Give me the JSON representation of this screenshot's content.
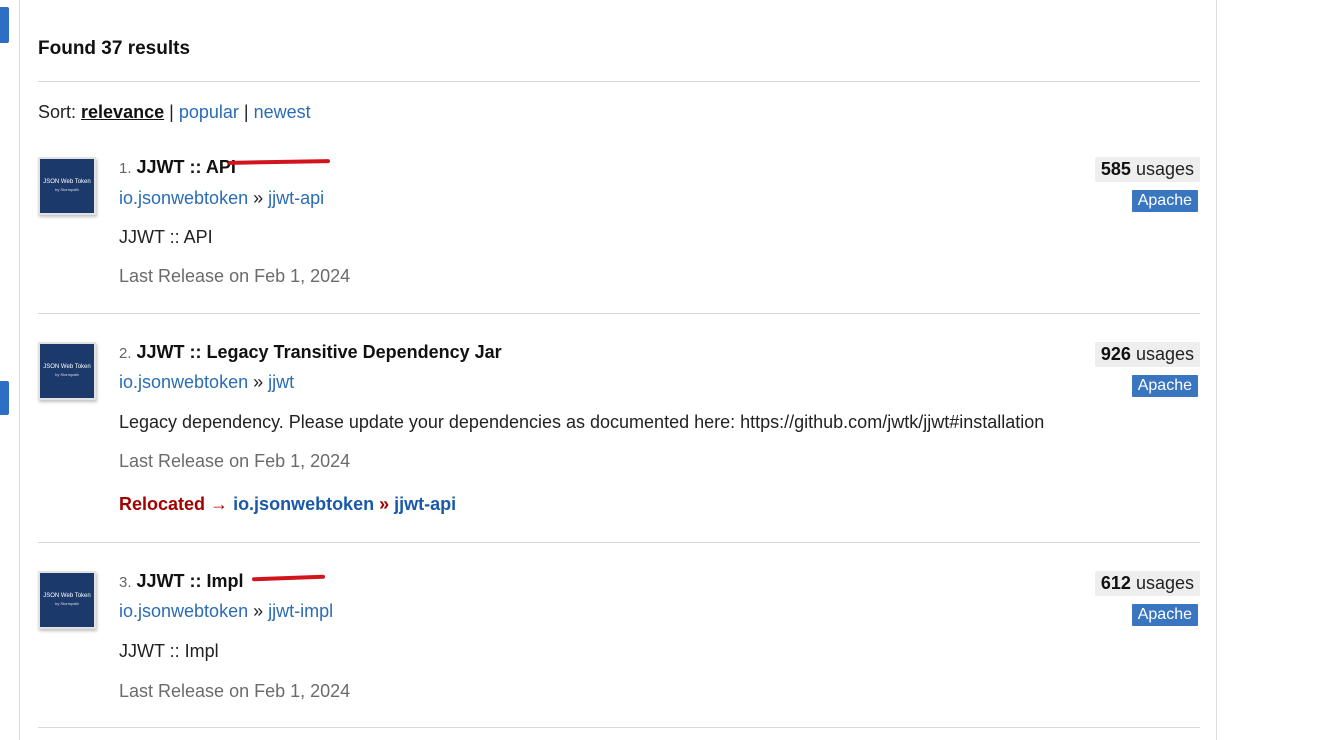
{
  "summary": {
    "found_text": "Found 37 results"
  },
  "sort": {
    "label": "Sort:",
    "options": [
      "relevance",
      "popular",
      "newest"
    ],
    "separator": "|"
  },
  "results": [
    {
      "index": "1.",
      "title": "JJWT :: API",
      "group": "io.jsonwebtoken",
      "artifact": "jjwt-api",
      "coord_sep": "»",
      "description": "JJWT :: API",
      "release": "Last Release on Feb 1, 2024",
      "usages_count": "585",
      "usages_label": "usages",
      "license": "Apache",
      "logo_text": "JSON Web Token",
      "logo_sub": "by Stormpath"
    },
    {
      "index": "2.",
      "title": "JJWT :: Legacy Transitive Dependency Jar",
      "group": "io.jsonwebtoken",
      "artifact": "jjwt",
      "coord_sep": "»",
      "description": "Legacy dependency. Please update your dependencies as documented here: https://github.com/jwtk/jjwt#installation",
      "release": "Last Release on Feb 1, 2024",
      "usages_count": "926",
      "usages_label": "usages",
      "license": "Apache",
      "logo_text": "JSON Web Token",
      "logo_sub": "by Stormpath",
      "relocated": {
        "label": "Relocated",
        "arrow": "→",
        "group": "io.jsonwebtoken",
        "sep": "»",
        "artifact": "jjwt-api"
      }
    },
    {
      "index": "3.",
      "title": "JJWT :: Impl",
      "group": "io.jsonwebtoken",
      "artifact": "jjwt-impl",
      "coord_sep": "»",
      "description": "JJWT :: Impl",
      "release": "Last Release on Feb 1, 2024",
      "usages_count": "612",
      "usages_label": "usages",
      "license": "Apache",
      "logo_text": "JSON Web Token",
      "logo_sub": "by Stormpath"
    }
  ],
  "colors": {
    "link": "#2a6cb5",
    "relocated": "#a30000",
    "license_badge": "#3a76c0",
    "annotation_mark": "#d2151d"
  }
}
